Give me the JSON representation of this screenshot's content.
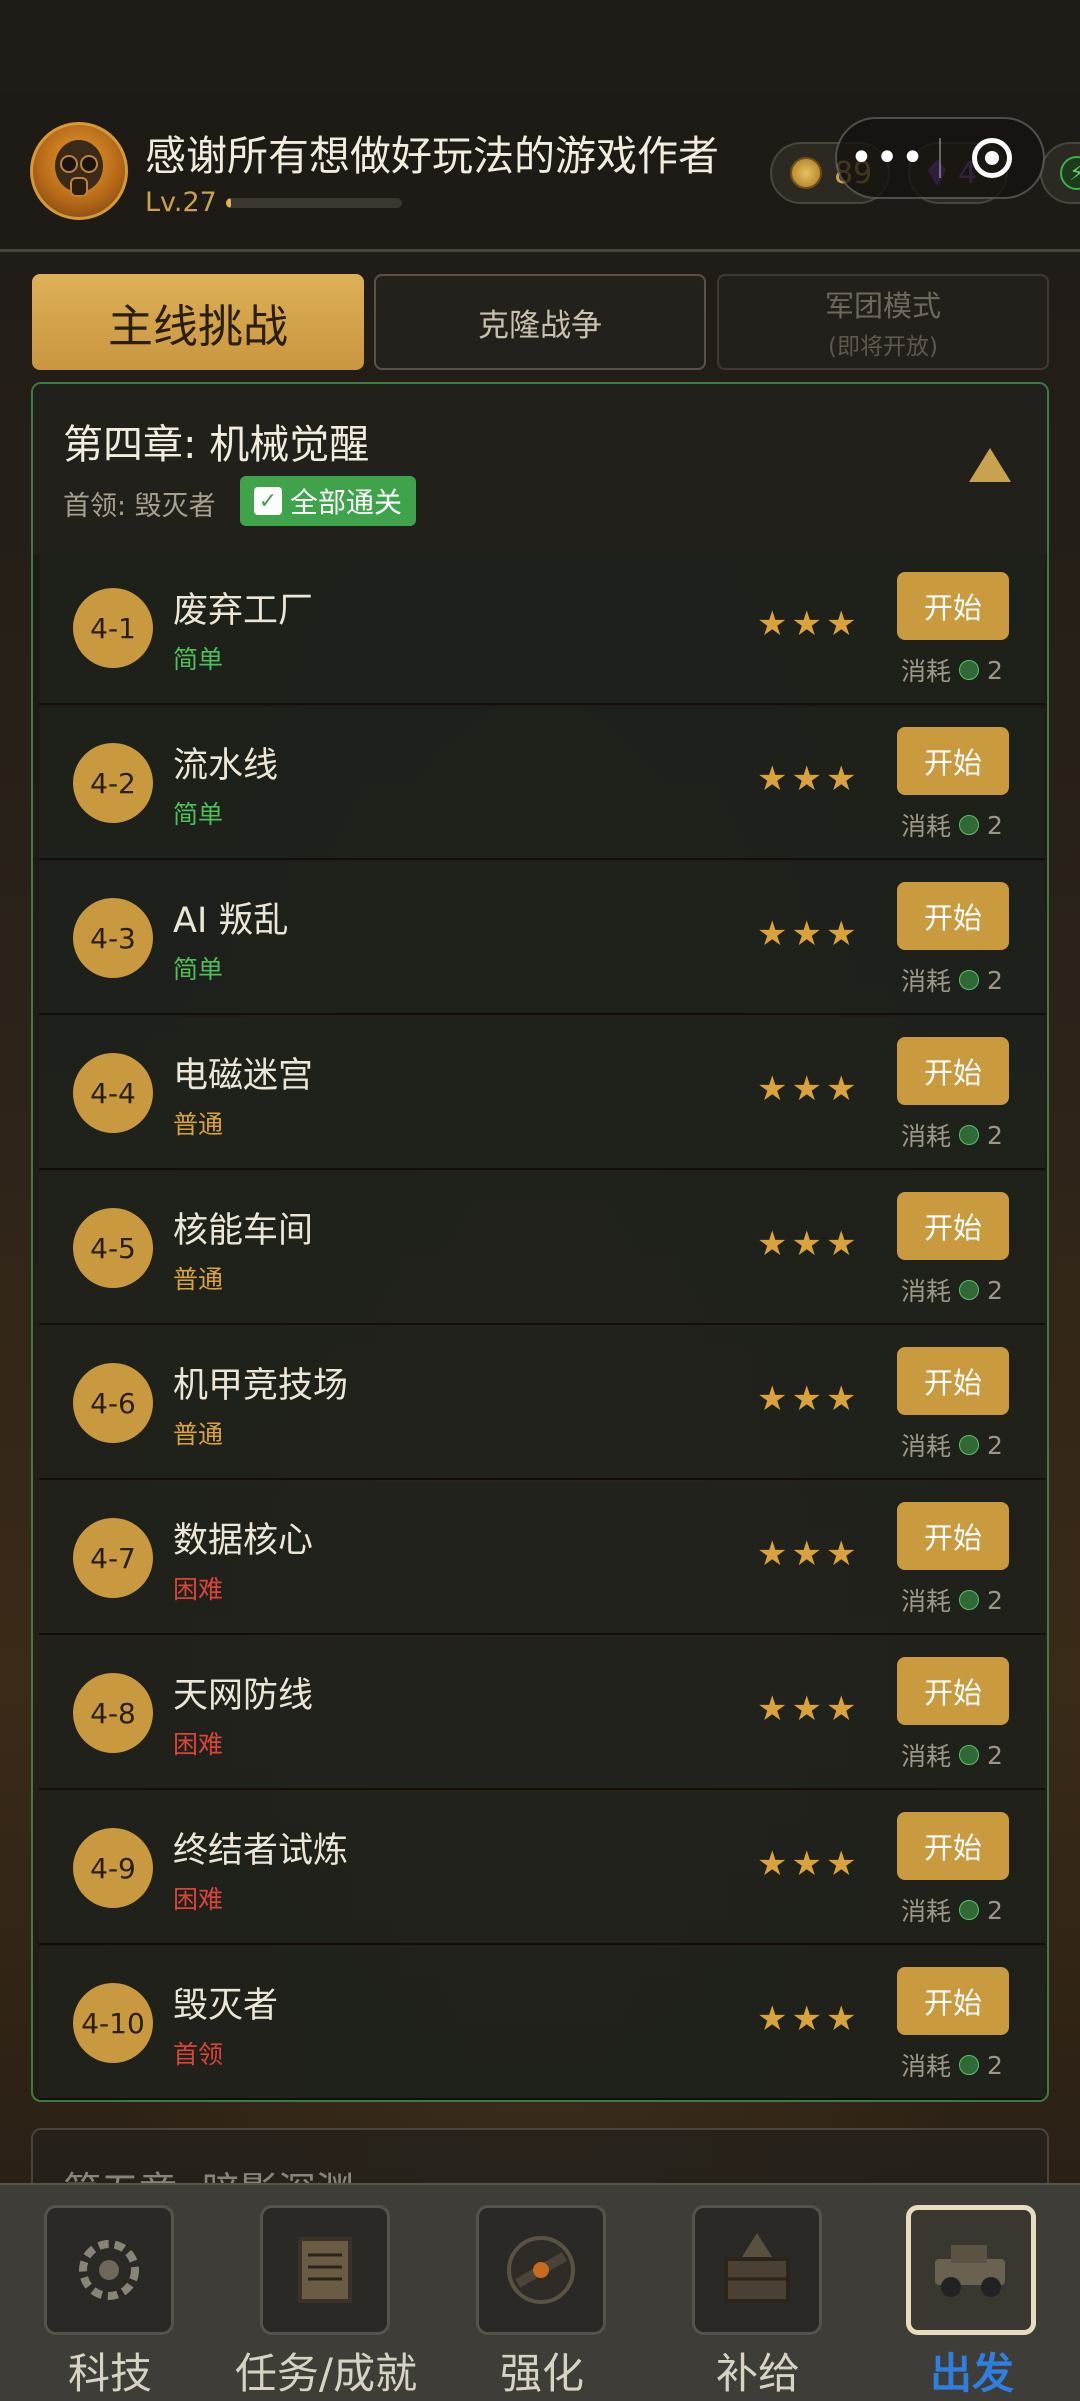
{
  "header": {
    "player_name": "感谢所有想做好玩法的游戏作者",
    "level": "Lv.27",
    "xp_fraction": 0.03,
    "coins": "89",
    "gems": "4",
    "colors": {
      "accent": "#c9a24e",
      "clear_green": "#3fa34c"
    }
  },
  "tabs": {
    "main": "主线挑战",
    "clone": "克隆战争",
    "legion": "军团模式",
    "legion_sub": "(即将开放)"
  },
  "chapter": {
    "title": "第四章: 机械觉醒",
    "boss": "首领: 毁灭者",
    "clear_badge": "全部通关",
    "levels": [
      {
        "id": "4-1",
        "name": "废弃工厂",
        "difficulty": "简单",
        "diff_class": "easy",
        "stars": "★★★",
        "start": "开始",
        "cost_label": "消耗",
        "cost": "2"
      },
      {
        "id": "4-2",
        "name": "流水线",
        "difficulty": "简单",
        "diff_class": "easy",
        "stars": "★★★",
        "start": "开始",
        "cost_label": "消耗",
        "cost": "2"
      },
      {
        "id": "4-3",
        "name": "AI 叛乱",
        "difficulty": "简单",
        "diff_class": "easy",
        "stars": "★★★",
        "start": "开始",
        "cost_label": "消耗",
        "cost": "2"
      },
      {
        "id": "4-4",
        "name": "电磁迷宫",
        "difficulty": "普通",
        "diff_class": "normal",
        "stars": "★★★",
        "start": "开始",
        "cost_label": "消耗",
        "cost": "2"
      },
      {
        "id": "4-5",
        "name": "核能车间",
        "difficulty": "普通",
        "diff_class": "normal",
        "stars": "★★★",
        "start": "开始",
        "cost_label": "消耗",
        "cost": "2"
      },
      {
        "id": "4-6",
        "name": "机甲竞技场",
        "difficulty": "普通",
        "diff_class": "normal",
        "stars": "★★★",
        "start": "开始",
        "cost_label": "消耗",
        "cost": "2"
      },
      {
        "id": "4-7",
        "name": "数据核心",
        "difficulty": "困难",
        "diff_class": "hard",
        "stars": "★★★",
        "start": "开始",
        "cost_label": "消耗",
        "cost": "2"
      },
      {
        "id": "4-8",
        "name": "天网防线",
        "difficulty": "困难",
        "diff_class": "hard",
        "stars": "★★★",
        "start": "开始",
        "cost_label": "消耗",
        "cost": "2"
      },
      {
        "id": "4-9",
        "name": "终结者试炼",
        "difficulty": "困难",
        "diff_class": "hard",
        "stars": "★★★",
        "start": "开始",
        "cost_label": "消耗",
        "cost": "2"
      },
      {
        "id": "4-10",
        "name": "毁灭者",
        "difficulty": "首领",
        "diff_class": "hard",
        "stars": "★★★",
        "start": "开始",
        "cost_label": "消耗",
        "cost": "2"
      }
    ]
  },
  "next_chapter": {
    "title": "第五章: 暗影深渊"
  },
  "nav": [
    {
      "label": "科技",
      "icon": "gear-icon",
      "active": false
    },
    {
      "label": "任务/成就",
      "icon": "scroll-icon",
      "active": false
    },
    {
      "label": "强化",
      "icon": "weapon-icon",
      "active": false
    },
    {
      "label": "补给",
      "icon": "crate-icon",
      "active": false
    },
    {
      "label": "出发",
      "icon": "vehicle-icon",
      "active": true
    }
  ]
}
